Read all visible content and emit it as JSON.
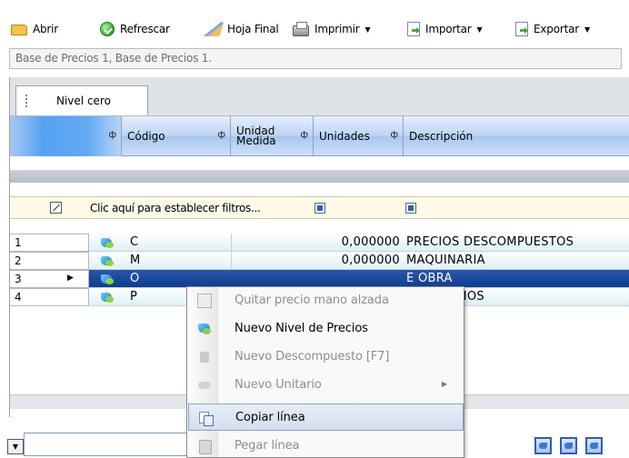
{
  "toolbar": {
    "abrir": "Abrir",
    "refrescar": "Refrescar",
    "hoja_final": "Hoja Final",
    "imprimir": "Imprimir",
    "importar": "Importar",
    "exportar": "Exportar",
    "dropdown_glyph": "▼"
  },
  "breadcrumb": "Base de Precios 1, Base de Precios 1.",
  "level_tab": "Nivel cero",
  "columns": {
    "codigo": "Código",
    "unidad_line1": "Unidad",
    "unidad_line2": "Medida",
    "unidades": "Unidades",
    "descripcion": "Descripción",
    "pin_glyph": "ф"
  },
  "filter_prompt": "Clic aquí para establecer filtros...",
  "rows": [
    {
      "index": "1",
      "code": "C",
      "units": "0,000000",
      "description": "PRECIOS DESCOMPUESTOS"
    },
    {
      "index": "2",
      "code": "M",
      "units": "0,000000",
      "description": "MAQUINARIA"
    },
    {
      "index": "3",
      "code": "O",
      "units": "",
      "description": "E OBRA",
      "selected": true
    },
    {
      "index": "4",
      "code": "P",
      "units": "",
      "description": "S UNITARIOS"
    }
  ],
  "selected_marker": "▶",
  "context_menu": {
    "items": [
      {
        "label": "Quitar precio mano alzada",
        "enabled": false
      },
      {
        "label": "Nuevo Nivel de Precios",
        "enabled": true
      },
      {
        "label": "Nuevo Descompuesto [F7]",
        "enabled": false
      },
      {
        "label": "Nuevo Unitario",
        "enabled": false
      },
      {
        "label": "Copiar línea",
        "enabled": true
      },
      {
        "label": "Pegar línea",
        "enabled": false
      }
    ],
    "submenu_glyph": "▶"
  },
  "bottom": {
    "combo_glyph": "▼"
  }
}
